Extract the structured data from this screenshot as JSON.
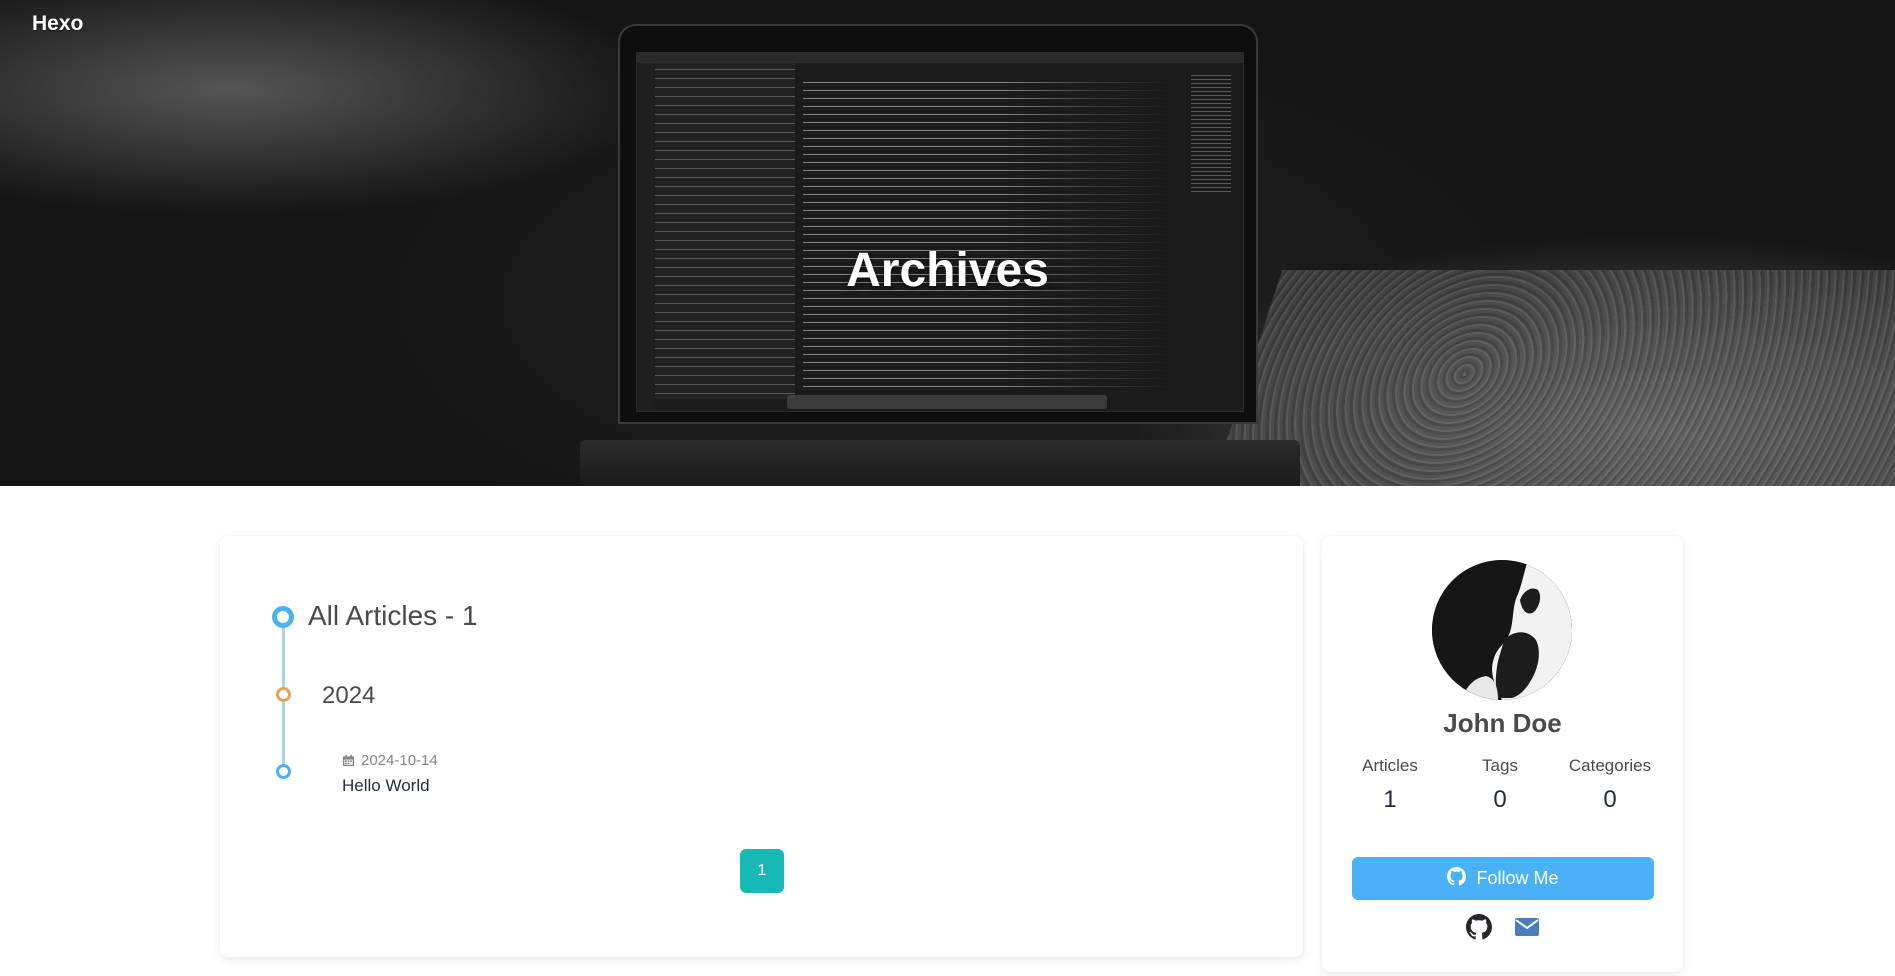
{
  "site": {
    "name": "Hexo"
  },
  "header": {
    "title": "Archives"
  },
  "archive": {
    "heading": "All Articles - 1",
    "years": [
      {
        "year": "2024",
        "posts": [
          {
            "date": "2024-10-14",
            "title": "Hello World"
          }
        ]
      }
    ],
    "pagination": {
      "current": "1"
    }
  },
  "author": {
    "name": "John Doe",
    "stats": [
      {
        "label": "Articles",
        "value": "1"
      },
      {
        "label": "Tags",
        "value": "0"
      },
      {
        "label": "Categories",
        "value": "0"
      }
    ],
    "follow_label": "Follow Me",
    "social_icons": [
      "github-icon",
      "envelope-icon"
    ]
  },
  "colors": {
    "accent": "#49b1f5",
    "pagination": "#17b8b6",
    "year_dot": "#e8a35a"
  }
}
